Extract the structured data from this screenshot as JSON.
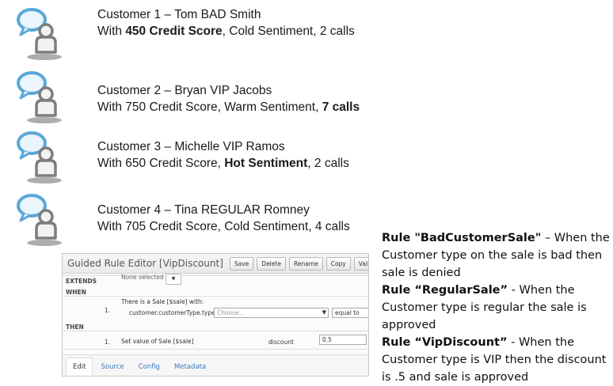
{
  "customers": [
    {
      "prefix": "Customer 1 – Tom BAD Smith",
      "line2_a": "With ",
      "line2_b": "450 Credit Score",
      "line2_c": ", Cold Sentiment, 2 calls"
    },
    {
      "prefix": "Customer 2 – Bryan VIP Jacobs",
      "line2_a": "With 750 Credit Score, Warm Sentiment, ",
      "line2_b": "7 calls",
      "line2_c": ""
    },
    {
      "prefix": "Customer 3 – Michelle VIP Ramos",
      "line2_a": "With 650 Credit Score, ",
      "line2_b": "Hot Sentiment",
      "line2_c": ", 2 calls"
    },
    {
      "prefix": "Customer 4 – Tina REGULAR Romney",
      "line2_a": "With 705 Credit Score, Cold Sentiment, 4 calls",
      "line2_b": "",
      "line2_c": ""
    }
  ],
  "rules": [
    {
      "name": "Rule \"BadCustomerSale\"",
      "desc": " – When the Customer type on the sale is bad then sale is denied"
    },
    {
      "name": "Rule “RegularSale”",
      "desc": " - When the Customer type is regular the sale is approved"
    },
    {
      "name": "Rule “VipDiscount”",
      "desc": " - When the Customer type is VIP then the discount is .5 and sale is approved"
    }
  ],
  "editor": {
    "title": "Guided Rule Editor [VipDiscount]",
    "buttons": {
      "save": "Save",
      "delete": "Delete",
      "rename": "Rename",
      "copy": "Copy",
      "validate": "Validate",
      "close": "✖"
    },
    "extends_label": "EXTENDS",
    "extends_value": "None selected",
    "when_label": "WHEN",
    "then_label": "THEN",
    "when_row_num": "1.",
    "when_pattern": "There is a Sale [$sale] with:",
    "when_field": "customer.customerType.type",
    "when_select": "Choose...",
    "when_operator": "equal to",
    "then_row_num": "1.",
    "then_action": "Set value of Sale [$sale]",
    "then_field": "discount",
    "then_value": "0.5",
    "tabs": {
      "edit": "Edit",
      "source": "Source",
      "config": "Config",
      "metadata": "Metadata"
    }
  },
  "colors": {
    "icon_blue": "#5aa8d8",
    "icon_gray": "#7d7d7d",
    "link": "#3a7ab8"
  }
}
